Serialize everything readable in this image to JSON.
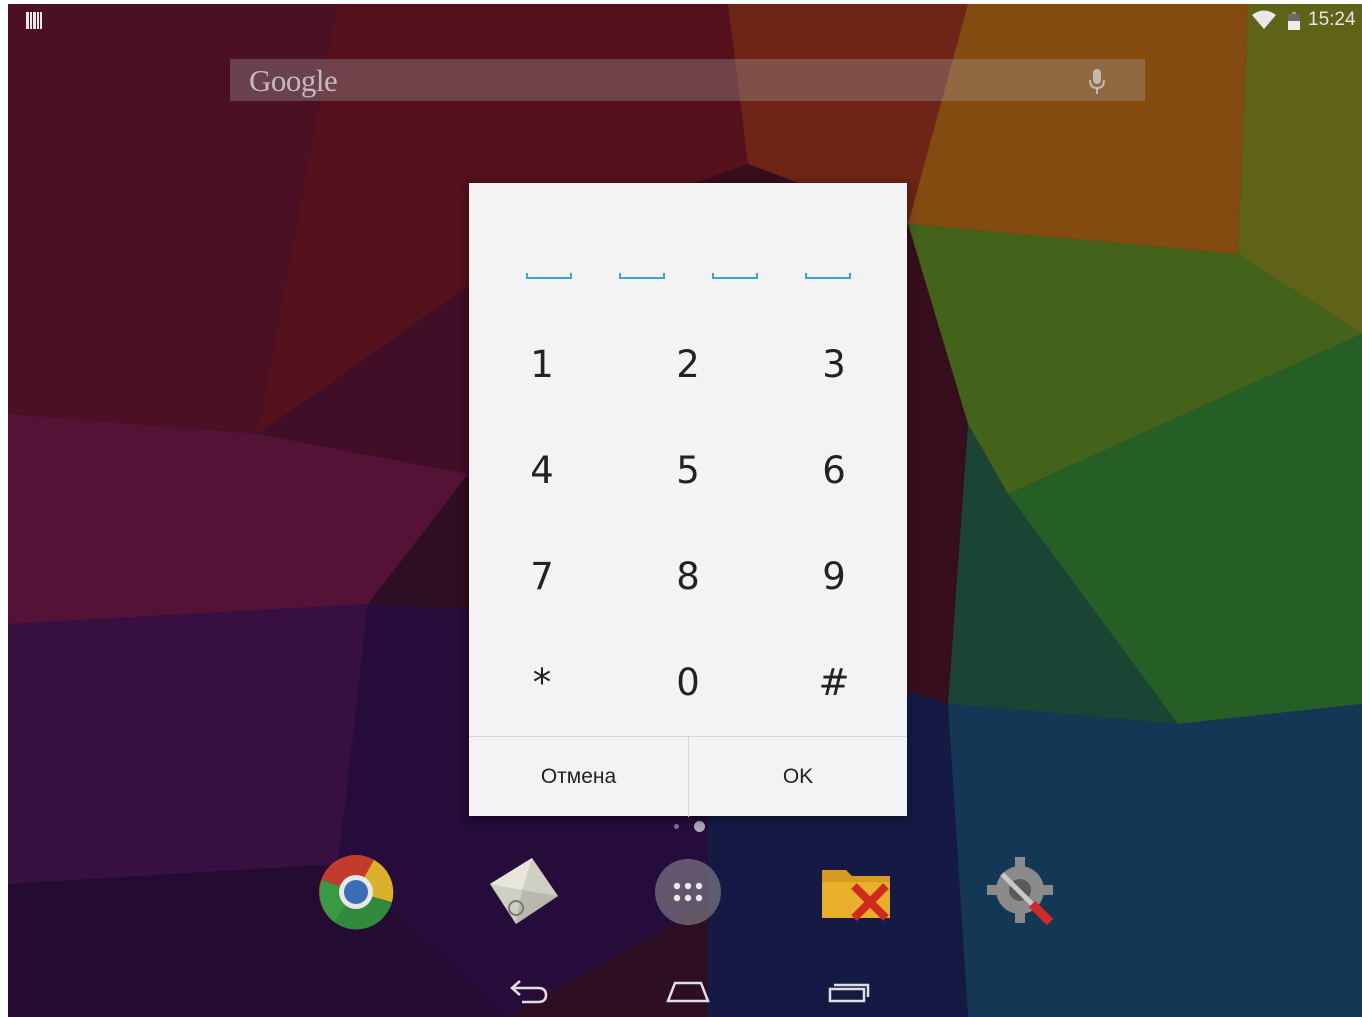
{
  "status_bar": {
    "time": "15:24",
    "icons": [
      "notification-icon",
      "wifi-icon",
      "battery-icon"
    ]
  },
  "search_bar": {
    "logo_text": "Google",
    "icon": "mic-icon"
  },
  "pin_dialog": {
    "slots": 4,
    "keypad": [
      [
        "1",
        "2",
        "3"
      ],
      [
        "4",
        "5",
        "6"
      ],
      [
        "7",
        "8",
        "9"
      ],
      [
        "*",
        "0",
        "#"
      ]
    ],
    "cancel_label": "Отмена",
    "ok_label": "OK",
    "accent_color": "#3aa6d0"
  },
  "dock": {
    "apps": [
      "chrome-icon",
      "email-icon",
      "app-drawer-icon",
      "file-manager-icon",
      "settings-tools-icon"
    ]
  },
  "nav_bar": {
    "buttons": [
      "back-icon",
      "home-icon",
      "recents-icon"
    ]
  }
}
